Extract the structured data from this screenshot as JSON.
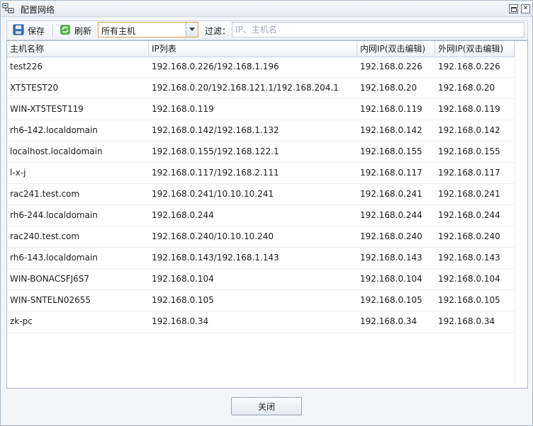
{
  "window": {
    "title": "配置网络",
    "app_icon": "network-config-icon",
    "maximize_icon": "maximize-icon",
    "close_icon": "close-icon"
  },
  "toolbar": {
    "save_label": "保存",
    "save_icon": "save-disk-icon",
    "refresh_label": "刷新",
    "refresh_icon": "refresh-icon",
    "host_filter": {
      "selected": "所有主机"
    },
    "filter_label": "过滤：",
    "filter_placeholder": "IP、主机名",
    "accent_color": "#d7a64f"
  },
  "grid": {
    "columns": [
      "主机名称",
      "IP列表",
      "内网IP(双击编辑)",
      "外网IP(双击编辑)"
    ],
    "rows": [
      {
        "host": "test226",
        "ips": "192.168.0.226/192.168.1.196",
        "internal": "192.168.0.226",
        "external": "192.168.0.226"
      },
      {
        "host": "XT5TEST20",
        "ips": "192.168.0.20/192.168.121.1/192.168.204.1",
        "internal": "192.168.0.20",
        "external": "192.168.0.20"
      },
      {
        "host": "WIN-XT5TEST119",
        "ips": "192.168.0.119",
        "internal": "192.168.0.119",
        "external": "192.168.0.119"
      },
      {
        "host": "rh6-142.localdomain",
        "ips": "192.168.0.142/192.168.1.132",
        "internal": "192.168.0.142",
        "external": "192.168.0.142"
      },
      {
        "host": "localhost.localdomain",
        "ips": "192.168.0.155/192.168.122.1",
        "internal": "192.168.0.155",
        "external": "192.168.0.155"
      },
      {
        "host": "l-x-j",
        "ips": "192.168.0.117/192.168.2.111",
        "internal": "192.168.0.117",
        "external": "192.168.0.117"
      },
      {
        "host": "rac241.test.com",
        "ips": "192.168.0.241/10.10.10.241",
        "internal": "192.168.0.241",
        "external": "192.168.0.241"
      },
      {
        "host": "rh6-244.localdomain",
        "ips": "192.168.0.244",
        "internal": "192.168.0.244",
        "external": "192.168.0.244"
      },
      {
        "host": "rac240.test.com",
        "ips": "192.168.0.240/10.10.10.240",
        "internal": "192.168.0.240",
        "external": "192.168.0.240"
      },
      {
        "host": "rh6-143.localdomain",
        "ips": "192.168.0.143/192.168.1.143",
        "internal": "192.168.0.143",
        "external": "192.168.0.143"
      },
      {
        "host": "WIN-BONACSFJ6S7",
        "ips": "192.168.0.104",
        "internal": "192.168.0.104",
        "external": "192.168.0.104"
      },
      {
        "host": "WIN-SNTELN02655",
        "ips": "192.168.0.105",
        "internal": "192.168.0.105",
        "external": "192.168.0.105"
      },
      {
        "host": "zk-pc",
        "ips": "192.168.0.34",
        "internal": "192.168.0.34",
        "external": "192.168.0.34"
      }
    ]
  },
  "footer": {
    "close_label": "关闭"
  }
}
